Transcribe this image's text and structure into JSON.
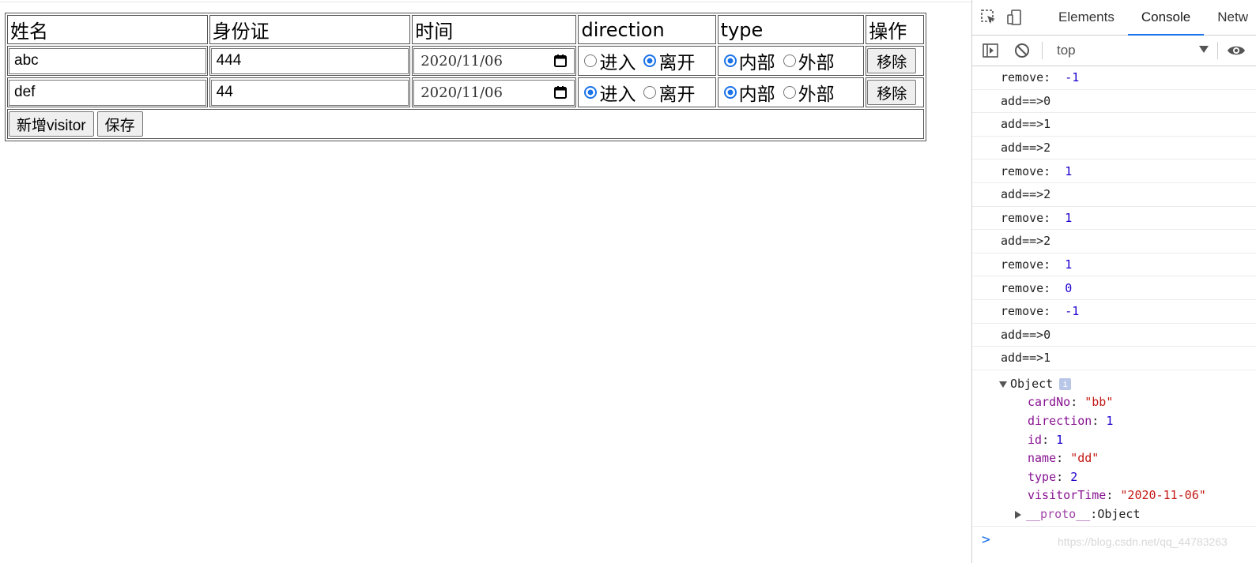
{
  "table": {
    "headers": [
      "姓名",
      "身份证",
      "时间",
      "direction",
      "type",
      "操作"
    ],
    "rows": [
      {
        "name": "abc",
        "card": "444",
        "date": "2020/11/06",
        "direction_options": [
          "进入",
          "离开"
        ],
        "direction_selected": 1,
        "type_options": [
          "内部",
          "外部"
        ],
        "type_selected": 0,
        "remove_label": "移除"
      },
      {
        "name": "def",
        "card": "44",
        "date": "2020/11/06",
        "direction_options": [
          "进入",
          "离开"
        ],
        "direction_selected": 0,
        "type_options": [
          "内部",
          "外部"
        ],
        "type_selected": 0,
        "remove_label": "移除"
      }
    ],
    "add_button": "新增visitor",
    "save_button": "保存"
  },
  "devtools": {
    "tabs": [
      "Elements",
      "Console",
      "Netw"
    ],
    "active_tab": "Console",
    "context": "top",
    "logs": [
      {
        "label": "remove:  ",
        "value": "-1"
      },
      {
        "label": "add==>0",
        "value": ""
      },
      {
        "label": "add==>1",
        "value": ""
      },
      {
        "label": "add==>2",
        "value": ""
      },
      {
        "label": "remove:  ",
        "value": "1"
      },
      {
        "label": "add==>2",
        "value": ""
      },
      {
        "label": "remove:  ",
        "value": "1"
      },
      {
        "label": "add==>2",
        "value": ""
      },
      {
        "label": "remove:  ",
        "value": "1"
      },
      {
        "label": "remove:  ",
        "value": "0"
      },
      {
        "label": "remove:  ",
        "value": "-1"
      },
      {
        "label": "add==>0",
        "value": ""
      },
      {
        "label": "add==>1",
        "value": ""
      }
    ],
    "object": {
      "label": "Object",
      "info": "i",
      "props": [
        {
          "key": "cardNo",
          "value": "\"bb\"",
          "kind": "string"
        },
        {
          "key": "direction",
          "value": "1",
          "kind": "number"
        },
        {
          "key": "id",
          "value": "1",
          "kind": "number"
        },
        {
          "key": "name",
          "value": "\"dd\"",
          "kind": "string"
        },
        {
          "key": "type",
          "value": "2",
          "kind": "number"
        },
        {
          "key": "visitorTime",
          "value": "\"2020-11-06\"",
          "kind": "string"
        }
      ],
      "proto_key": "__proto__",
      "proto_value": "Object"
    },
    "prompt": ">",
    "watermark": "https://blog.csdn.net/qq_44783263"
  }
}
